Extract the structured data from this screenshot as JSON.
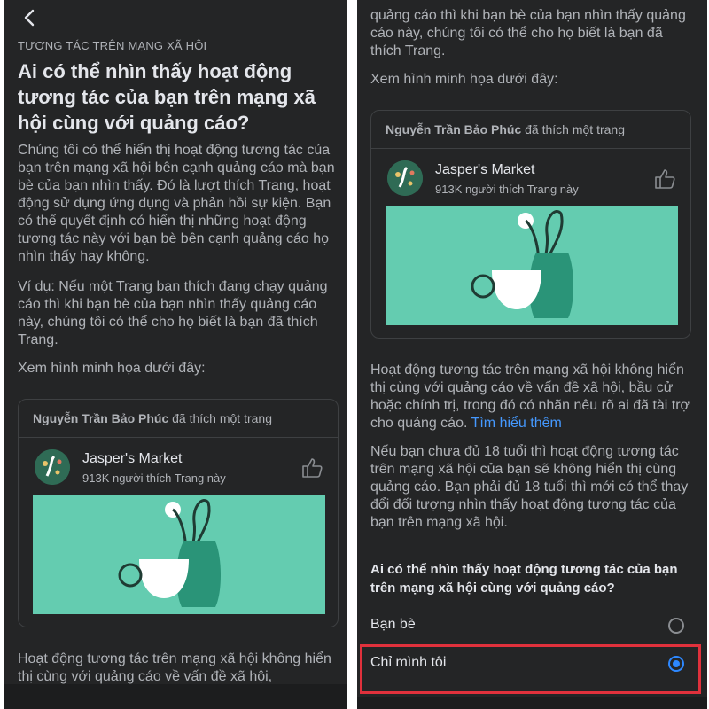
{
  "left": {
    "section_label": "TƯƠNG TÁC TRÊN MẠNG XÃ HỘI",
    "title": "Ai có thể nhìn thấy hoạt động tương tác của bạn trên mạng xã hội cùng với quảng cáo?",
    "para1": "Chúng tôi có thể hiển thị hoạt động tương tác của bạn trên mạng xã hội bên cạnh quảng cáo mà bạn bè của bạn nhìn thấy. Đó là lượt thích Trang, hoạt động sử dụng ứng dụng và phản hồi sự kiện. Bạn có thể quyết định có hiển thị những hoạt động tương tác này với bạn bè bên cạnh quảng cáo họ nhìn thấy hay không.",
    "para2": "Ví dụ: Nếu một Trang bạn thích đang chạy quảng cáo thì khi bạn bè của bạn nhìn thấy quảng cáo này, chúng tôi có thể cho họ biết là bạn đã thích Trang.",
    "para3": "Xem hình minh họa dưới đây:",
    "para4": "Hoạt động tương tác trên mạng xã hội không hiển thị cùng với quảng cáo về vấn đề xã hội,"
  },
  "card": {
    "user_name": "Nguyễn Trần Bảo Phúc",
    "action_text": "đã thích một trang",
    "page_name": "Jasper's Market",
    "page_likes": "913K người thích Trang này"
  },
  "right": {
    "top_para": "quảng cáo thì khi bạn bè của bạn nhìn thấy quảng cáo này, chúng tôi có thể cho họ biết là bạn đã thích Trang.",
    "para3": "Xem hình minh họa dưới đây:",
    "para4": "Hoạt động tương tác trên mạng xã hội không hiển thị cùng với quảng cáo về vấn đề xã hội, bầu cử hoặc chính trị, trong đó có nhãn nêu rõ ai đã tài trợ cho quảng cáo.",
    "learn_more": "Tìm hiểu thêm",
    "para5": "Nếu bạn chưa đủ 18 tuổi thì hoạt động tương tác trên mạng xã hội của bạn sẽ không hiển thị cùng quảng cáo. Bạn phải đủ 18 tuổi thì mới có thể thay đổi đối tượng nhìn thấy hoạt động tương tác của bạn trên mạng xã hội.",
    "question": "Ai có thể nhìn thấy hoạt động tương tác của bạn trên mạng xã hội cùng với quảng cáo?",
    "options": [
      {
        "label": "Bạn bè",
        "selected": false
      },
      {
        "label": "Chỉ mình tôi",
        "selected": true
      }
    ]
  },
  "colors": {
    "background": "#242526",
    "accent": "#2d88ff",
    "illustration": "#64ccb0",
    "highlight": "#e0313c"
  },
  "icons": [
    "back-arrow-icon",
    "page-avatar-icon",
    "like-thumb-icon"
  ]
}
